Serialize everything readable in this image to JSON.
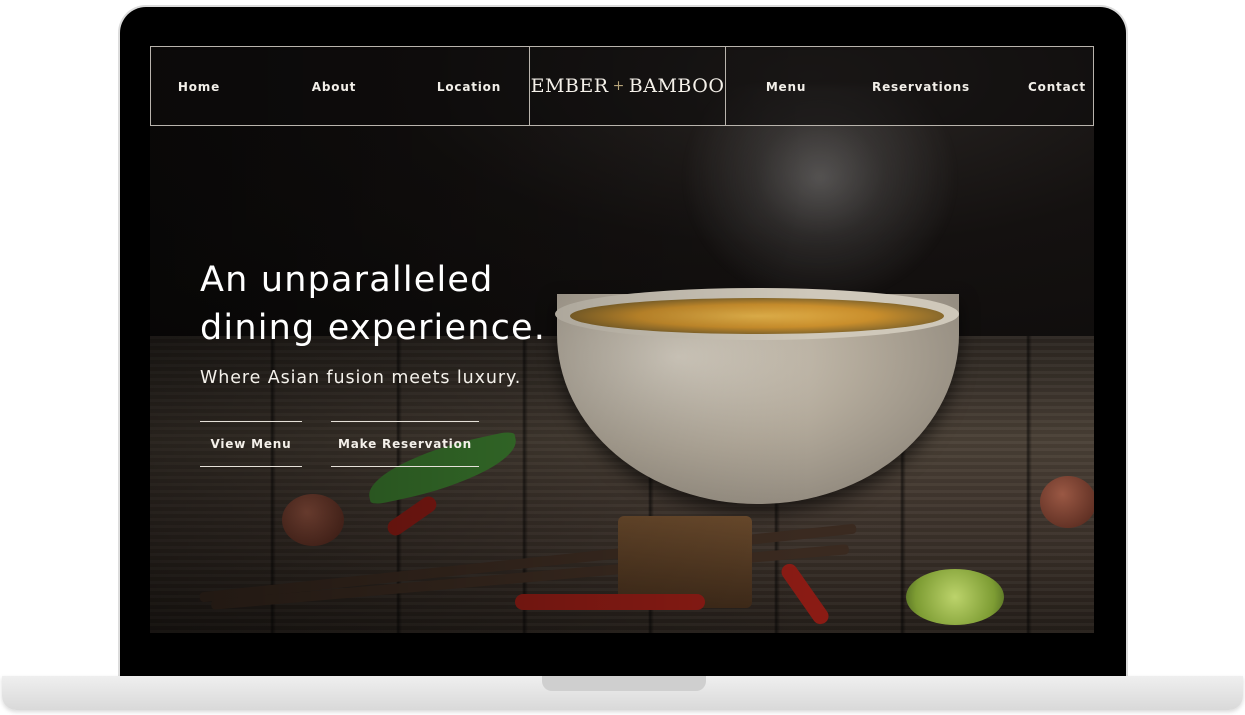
{
  "nav": {
    "left_items": [
      "Home",
      "About",
      "Location"
    ],
    "brand": {
      "left": "EMBER",
      "separator": "+",
      "right": "BAMBOO"
    },
    "right_items": [
      "Menu",
      "Reservations",
      "Contact"
    ]
  },
  "hero": {
    "title_line1": "An unparalleled",
    "title_line2": "dining experience.",
    "subtitle": "Where Asian fusion meets luxury.",
    "buttons": [
      "View Menu",
      "Make Reservation"
    ]
  },
  "colors": {
    "nav_border": "#b9b4ad",
    "text": "#f2efe9",
    "brand_accent": "#b7a47a",
    "bezel": "#000000"
  },
  "images": {
    "hero_photo": "steaming noodle bowl on rustic wooden table"
  }
}
